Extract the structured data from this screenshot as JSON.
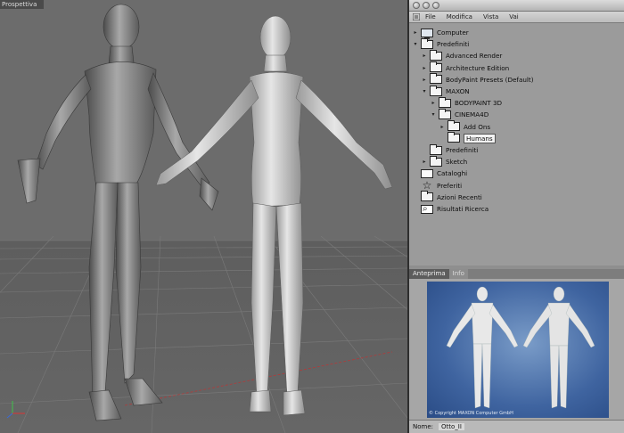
{
  "viewport": {
    "label": "Prospettiva"
  },
  "browser": {
    "menu": [
      "File",
      "Modifica",
      "Vista",
      "Vai"
    ],
    "tree": [
      {
        "label": "Computer",
        "icon": "computer-icon",
        "indent": 0,
        "expander": "collapsed"
      },
      {
        "label": "Predefiniti",
        "icon": "folder-icon",
        "indent": 0,
        "expander": "expanded"
      },
      {
        "label": "Advanced Render",
        "icon": "folder-icon",
        "indent": 1,
        "expander": "collapsed"
      },
      {
        "label": "Architecture Edition",
        "icon": "folder-icon",
        "indent": 1,
        "expander": "collapsed"
      },
      {
        "label": "BodyPaint Presets (Default)",
        "icon": "folder-icon",
        "indent": 1,
        "expander": "collapsed"
      },
      {
        "label": "MAXON",
        "icon": "folder-icon",
        "indent": 1,
        "expander": "expanded"
      },
      {
        "label": "BODYPAINT 3D",
        "icon": "folder-icon",
        "indent": 2,
        "expander": "collapsed"
      },
      {
        "label": "CINEMA4D",
        "icon": "folder-icon",
        "indent": 2,
        "expander": "expanded"
      },
      {
        "label": "Add Ons",
        "icon": "folder-icon",
        "indent": 3,
        "expander": "collapsed"
      },
      {
        "label": "Humans",
        "icon": "folder-icon",
        "indent": 3,
        "expander": "none",
        "selected": true
      },
      {
        "label": "Predefiniti",
        "icon": "folder-icon",
        "indent": 1,
        "expander": "none"
      },
      {
        "label": "Sketch",
        "icon": "folder-icon",
        "indent": 1,
        "expander": "collapsed"
      },
      {
        "label": "Cataloghi",
        "icon": "doc-icon",
        "indent": 0,
        "expander": "none"
      },
      {
        "label": "Preferiti",
        "icon": "star-icon",
        "indent": 0,
        "expander": "none"
      },
      {
        "label": "Azioni Recenti",
        "icon": "folder-icon",
        "indent": 0,
        "expander": "none"
      },
      {
        "label": "Risultati Ricerca",
        "icon": "search-icon",
        "indent": 0,
        "expander": "none"
      }
    ],
    "tabs": [
      {
        "label": "Anteprima",
        "active": true
      },
      {
        "label": "Info",
        "active": false
      }
    ],
    "preview_caption": "© Copyright MAXON Computer GmbH",
    "name_label": "Nome",
    "name_value": "Otto_II"
  },
  "colors": {
    "viewport_bg": "#6c6c6c",
    "panel_bg": "#9b9b9b",
    "preview_bg": "#3f64a0"
  }
}
